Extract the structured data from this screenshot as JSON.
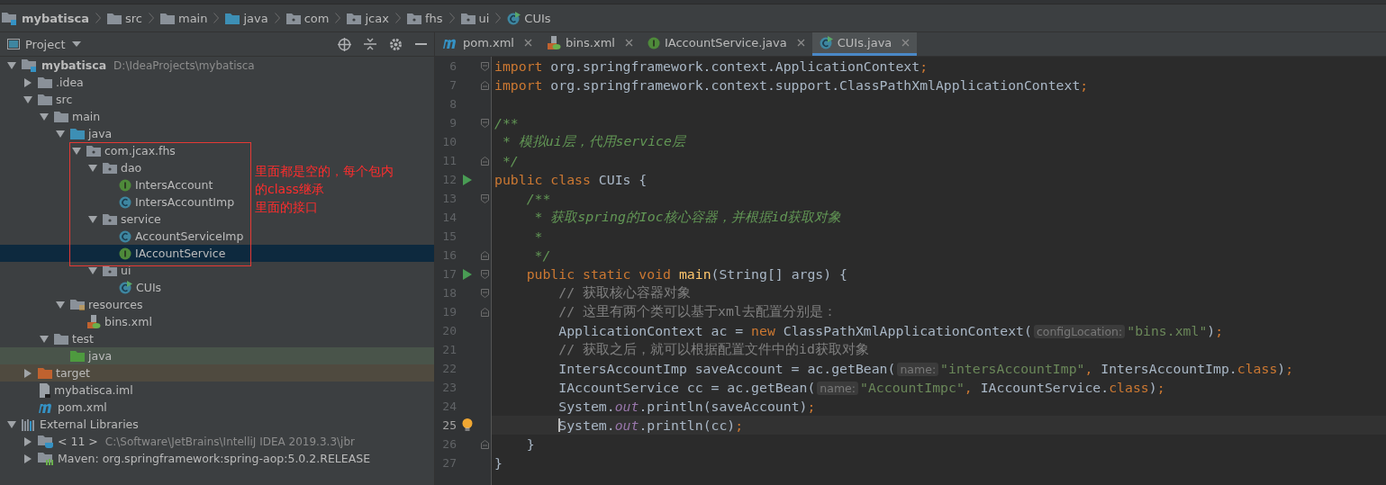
{
  "breadcrumbs": [
    {
      "label": "mybatisca",
      "kind": "module"
    },
    {
      "label": "src",
      "kind": "folder"
    },
    {
      "label": "main",
      "kind": "folder"
    },
    {
      "label": "java",
      "kind": "source"
    },
    {
      "label": "com",
      "kind": "package"
    },
    {
      "label": "jcax",
      "kind": "package"
    },
    {
      "label": "fhs",
      "kind": "package"
    },
    {
      "label": "ui",
      "kind": "package"
    },
    {
      "label": "CUIs",
      "kind": "main-class"
    }
  ],
  "project_panel": {
    "title": "Project",
    "tree": [
      {
        "label": "mybatisca",
        "detail": "D:\\IdeaProjects\\mybatisca",
        "kind": "module",
        "expanded": true,
        "selected": false,
        "children": [
          {
            "label": ".idea",
            "kind": "folder",
            "expanded": false,
            "selected": false
          },
          {
            "label": "src",
            "kind": "folder",
            "expanded": true,
            "selected": false,
            "children": [
              {
                "label": "main",
                "kind": "folder",
                "expanded": true,
                "selected": false,
                "children": [
                  {
                    "label": "java",
                    "kind": "source",
                    "expanded": true,
                    "selected": false,
                    "children": [
                      {
                        "label": "com.jcax.fhs",
                        "kind": "package",
                        "expanded": true,
                        "selected": false,
                        "children": [
                          {
                            "label": "dao",
                            "kind": "package",
                            "expanded": true,
                            "selected": false,
                            "children": [
                              {
                                "label": "IntersAccount",
                                "kind": "interface",
                                "selected": false
                              },
                              {
                                "label": "IntersAccountImp",
                                "kind": "class",
                                "selected": false
                              }
                            ]
                          },
                          {
                            "label": "service",
                            "kind": "package",
                            "expanded": true,
                            "selected": false,
                            "children": [
                              {
                                "label": "AccountServiceImp",
                                "kind": "class",
                                "selected": false
                              },
                              {
                                "label": "IAccountService",
                                "kind": "interface",
                                "selected": true
                              }
                            ]
                          },
                          {
                            "label": "ui",
                            "kind": "package",
                            "expanded": true,
                            "selected": false,
                            "children": [
                              {
                                "label": "CUIs",
                                "kind": "main-class",
                                "selected": false
                              }
                            ]
                          }
                        ]
                      }
                    ]
                  },
                  {
                    "label": "resources",
                    "kind": "resources",
                    "expanded": true,
                    "selected": false,
                    "children": [
                      {
                        "label": "bins.xml",
                        "kind": "xml",
                        "selected": false
                      }
                    ]
                  }
                ]
              },
              {
                "label": "test",
                "kind": "folder",
                "expanded": true,
                "selected": false,
                "children": [
                  {
                    "label": "java",
                    "kind": "test-source",
                    "selected": false
                  }
                ]
              }
            ]
          },
          {
            "label": "target",
            "kind": "excluded",
            "expanded": false,
            "selected": false
          },
          {
            "label": "mybatisca.iml",
            "kind": "iml",
            "selected": false
          },
          {
            "label": "pom.xml",
            "kind": "maven",
            "selected": false
          }
        ]
      },
      {
        "label": "External Libraries",
        "kind": "libraries",
        "expanded": true,
        "selected": false,
        "children": [
          {
            "label": "< 11 >",
            "detail": "C:\\Software\\JetBrains\\IntelliJ IDEA 2019.3.3\\jbr",
            "kind": "jdk",
            "expanded": false,
            "selected": false
          },
          {
            "label": "Maven: org.springframework:spring-aop:5.0.2.RELEASE",
            "kind": "library",
            "expanded": false,
            "selected": false
          }
        ]
      }
    ],
    "annotation": [
      "里面都是空的，每个包内",
      "的class继承",
      "里面的接口"
    ]
  },
  "tabs": [
    {
      "label": "pom.xml",
      "kind": "maven",
      "selected": false
    },
    {
      "label": "bins.xml",
      "kind": "xml",
      "selected": false
    },
    {
      "label": "IAccountService.java",
      "kind": "interface",
      "selected": false
    },
    {
      "label": "CUIs.java",
      "kind": "main-class",
      "selected": true
    }
  ],
  "editor": {
    "lines": [
      {
        "number": "6",
        "gutter": [
          {
            "kind": "fold-start"
          }
        ],
        "current": false,
        "tokens": [
          {
            "kind": "keyword",
            "text": "import "
          },
          {
            "kind": "plain",
            "text": "org.springframework.context.ApplicationContext"
          },
          {
            "kind": "keyword",
            "text": ";"
          }
        ]
      },
      {
        "number": "7",
        "gutter": [
          {
            "kind": "fold-end"
          }
        ],
        "current": false,
        "tokens": [
          {
            "kind": "keyword",
            "text": "import "
          },
          {
            "kind": "plain",
            "text": "org.springframework.context.support.ClassPathXmlApplicationContext"
          },
          {
            "kind": "keyword",
            "text": ";"
          }
        ]
      },
      {
        "number": "8",
        "current": false
      },
      {
        "number": "9",
        "gutter": [
          {
            "kind": "fold-start"
          }
        ],
        "current": false,
        "tokens": [
          {
            "kind": "doc",
            "text": "/**"
          }
        ]
      },
      {
        "number": "10",
        "current": false,
        "tokens": [
          {
            "kind": "doc",
            "text": " * 模拟ui层，代用service层"
          }
        ]
      },
      {
        "number": "11",
        "gutter": [
          {
            "kind": "fold-end"
          }
        ],
        "current": false,
        "tokens": [
          {
            "kind": "doc",
            "text": " */"
          }
        ]
      },
      {
        "number": "12",
        "gutter": [
          {
            "kind": "run"
          }
        ],
        "current": false,
        "tokens": [
          {
            "kind": "keyword",
            "text": "public class "
          },
          {
            "kind": "plain",
            "text": "CUIs {"
          }
        ]
      },
      {
        "number": "13",
        "gutter": [
          {
            "kind": "fold-start"
          }
        ],
        "current": false,
        "tokens": [
          {
            "kind": "doc",
            "text": "    /**"
          }
        ]
      },
      {
        "number": "14",
        "current": false,
        "tokens": [
          {
            "kind": "doc",
            "text": "     * 获取spring的Ioc核心容器，并根据id获取对象"
          }
        ]
      },
      {
        "number": "15",
        "current": false,
        "tokens": [
          {
            "kind": "doc",
            "text": "     *"
          }
        ]
      },
      {
        "number": "16",
        "gutter": [
          {
            "kind": "fold-end"
          }
        ],
        "current": false,
        "tokens": [
          {
            "kind": "doc",
            "text": "     */"
          }
        ]
      },
      {
        "number": "17",
        "gutter": [
          {
            "kind": "run"
          },
          {
            "kind": "fold-start"
          }
        ],
        "current": false,
        "tokens": [
          {
            "kind": "keyword",
            "text": "    public static void "
          },
          {
            "kind": "method",
            "text": "main"
          },
          {
            "kind": "plain",
            "text": "(String[] args) {"
          }
        ]
      },
      {
        "number": "18",
        "gutter": [
          {
            "kind": "fold-start"
          }
        ],
        "current": false,
        "tokens": [
          {
            "kind": "comment",
            "text": "        // 获取核心容器对象"
          }
        ]
      },
      {
        "number": "19",
        "gutter": [
          {
            "kind": "fold-end"
          }
        ],
        "current": false,
        "tokens": [
          {
            "kind": "comment",
            "text": "        // 这里有两个类可以基于xml去配置分别是："
          }
        ]
      },
      {
        "number": "20",
        "current": false,
        "tokens": [
          {
            "kind": "plain",
            "text": "        ApplicationContext ac = "
          },
          {
            "kind": "keyword",
            "text": "new "
          },
          {
            "kind": "plain",
            "text": "ClassPathXmlApplicationContext("
          },
          {
            "kind": "hint",
            "text": "configLocation:"
          },
          {
            "kind": "string",
            "text": "\"bins.xml\""
          },
          {
            "kind": "plain",
            "text": ")"
          },
          {
            "kind": "keyword",
            "text": ";"
          }
        ]
      },
      {
        "number": "21",
        "current": false,
        "tokens": [
          {
            "kind": "comment",
            "text": "        // 获取之后，就可以根据配置文件中的id获取对象"
          }
        ]
      },
      {
        "number": "22",
        "current": false,
        "tokens": [
          {
            "kind": "plain",
            "text": "        IntersAccountImp saveAccount = ac.getBean("
          },
          {
            "kind": "hint",
            "text": "name:"
          },
          {
            "kind": "string",
            "text": "\"intersAccountImp\""
          },
          {
            "kind": "keyword",
            "text": ", "
          },
          {
            "kind": "plain",
            "text": "IntersAccountImp."
          },
          {
            "kind": "keyword",
            "text": "class"
          },
          {
            "kind": "plain",
            "text": ")"
          },
          {
            "kind": "keyword",
            "text": ";"
          }
        ]
      },
      {
        "number": "23",
        "current": false,
        "tokens": [
          {
            "kind": "plain",
            "text": "        IAccountService cc = ac.getBean("
          },
          {
            "kind": "hint",
            "text": "name:"
          },
          {
            "kind": "string",
            "text": "\"AccountImpc\""
          },
          {
            "kind": "keyword",
            "text": ", "
          },
          {
            "kind": "plain",
            "text": "IAccountService."
          },
          {
            "kind": "keyword",
            "text": "class"
          },
          {
            "kind": "plain",
            "text": ")"
          },
          {
            "kind": "keyword",
            "text": ";"
          }
        ]
      },
      {
        "number": "24",
        "current": false,
        "tokens": [
          {
            "kind": "plain",
            "text": "        System."
          },
          {
            "kind": "field",
            "text": "out"
          },
          {
            "kind": "plain",
            "text": ".println(saveAccount)"
          },
          {
            "kind": "keyword",
            "text": ";"
          }
        ]
      },
      {
        "number": "25",
        "gutter": [
          {
            "kind": "bulb"
          }
        ],
        "current": true,
        "tokens": [
          {
            "kind": "plain",
            "text": "        System."
          },
          {
            "kind": "field",
            "text": "out"
          },
          {
            "kind": "plain",
            "text": ".println(cc)"
          },
          {
            "kind": "keyword",
            "text": ";"
          }
        ]
      },
      {
        "number": "26",
        "gutter": [
          {
            "kind": "fold-end"
          }
        ],
        "current": false,
        "tokens": [
          {
            "kind": "plain",
            "text": "    }"
          }
        ]
      },
      {
        "number": "27",
        "current": false,
        "tokens": [
          {
            "kind": "plain",
            "text": "}"
          }
        ]
      }
    ]
  }
}
